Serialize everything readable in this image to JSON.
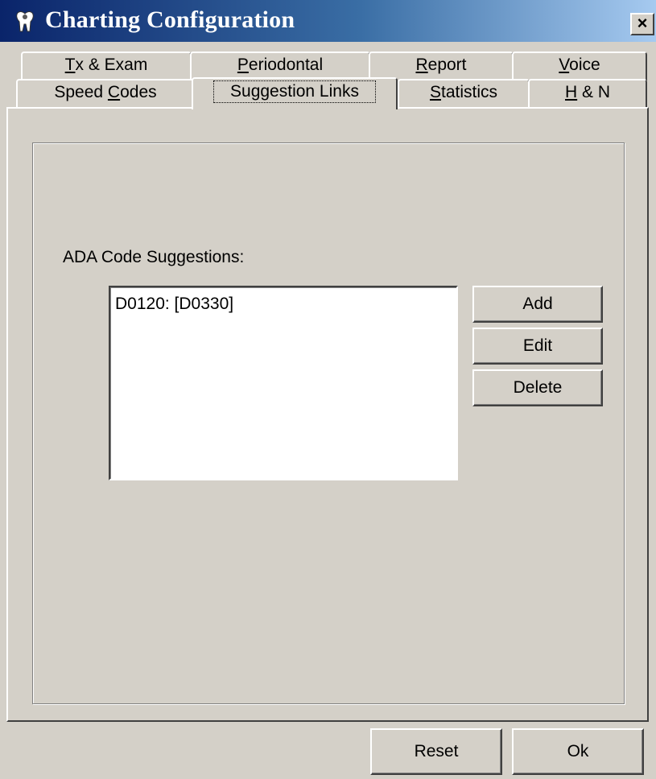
{
  "window": {
    "title": "Charting Configuration",
    "close_label": "×"
  },
  "tabs": {
    "row_top": [
      {
        "key": "T",
        "rest": "x & Exam"
      },
      {
        "key": "P",
        "rest": "eriodontal"
      },
      {
        "key": "R",
        "rest": "eport"
      },
      {
        "key": "V",
        "rest": "oice"
      }
    ],
    "row_bottom": [
      {
        "before": "Speed ",
        "key": "C",
        "rest": "odes"
      },
      {
        "label": "Suggestion Links",
        "selected": true
      },
      {
        "key": "S",
        "rest": "tatistics"
      },
      {
        "key": "H",
        "rest": " & N"
      }
    ]
  },
  "panel": {
    "label": "ADA Code Suggestions:",
    "items": [
      "D0120: [D0330]"
    ],
    "buttons": {
      "add": "Add",
      "edit": "Edit",
      "delete": "Delete"
    }
  },
  "footer": {
    "reset": "Reset",
    "ok": "Ok"
  },
  "colors": {
    "title_gradient_start": "#0a246a",
    "title_gradient_end": "#a6caf0",
    "face": "#d4d0c8"
  }
}
